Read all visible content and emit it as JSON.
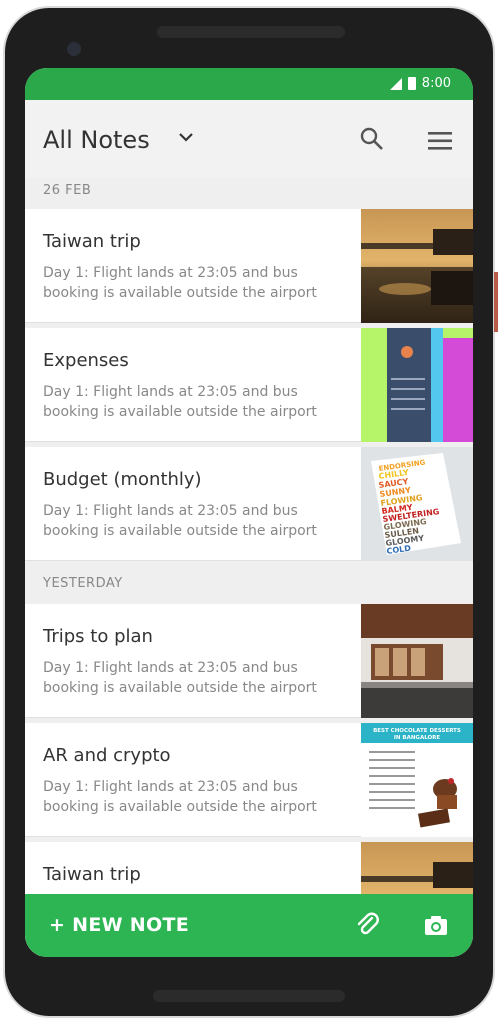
{
  "status": {
    "time": "8:00"
  },
  "header": {
    "title": "All Notes"
  },
  "sections": {
    "first": "26 FEB",
    "second": "YESTERDAY"
  },
  "notes": [
    {
      "title": "Taiwan trip",
      "snippet": "Day 1: Flight lands at 23:05 and bus booking is available outside the airport"
    },
    {
      "title": "Expenses",
      "snippet": "Day 1: Flight lands at 23:05 and bus booking is available outside the airport"
    },
    {
      "title": "Budget (monthly)",
      "snippet": "Day 1: Flight lands at 23:05 and bus booking is available outside the airport"
    },
    {
      "title": "Trips to plan",
      "snippet": "Day 1: Flight lands at 23:05 and bus booking is available outside the airport"
    },
    {
      "title": "AR and crypto",
      "snippet": "Day 1: Flight lands at 23:05 and bus booking is available outside the airport"
    },
    {
      "title": "Taiwan trip",
      "snippet": ""
    }
  ],
  "thumbs": {
    "budget_words": [
      "ENDORSING",
      "CHILLY",
      "SAUCY",
      "SUNNY",
      "FLOWING",
      "BALMY",
      "SWELTERING",
      "GLOWING",
      "SULLEN",
      "GLOOMY",
      "COLD"
    ],
    "choc_title": "BEST CHOCOLATE DESSERTS IN BANGALORE"
  },
  "bottom": {
    "new_note": "+ NEW NOTE"
  },
  "colors": {
    "accent": "#2db553",
    "status": "#2aa84a"
  }
}
